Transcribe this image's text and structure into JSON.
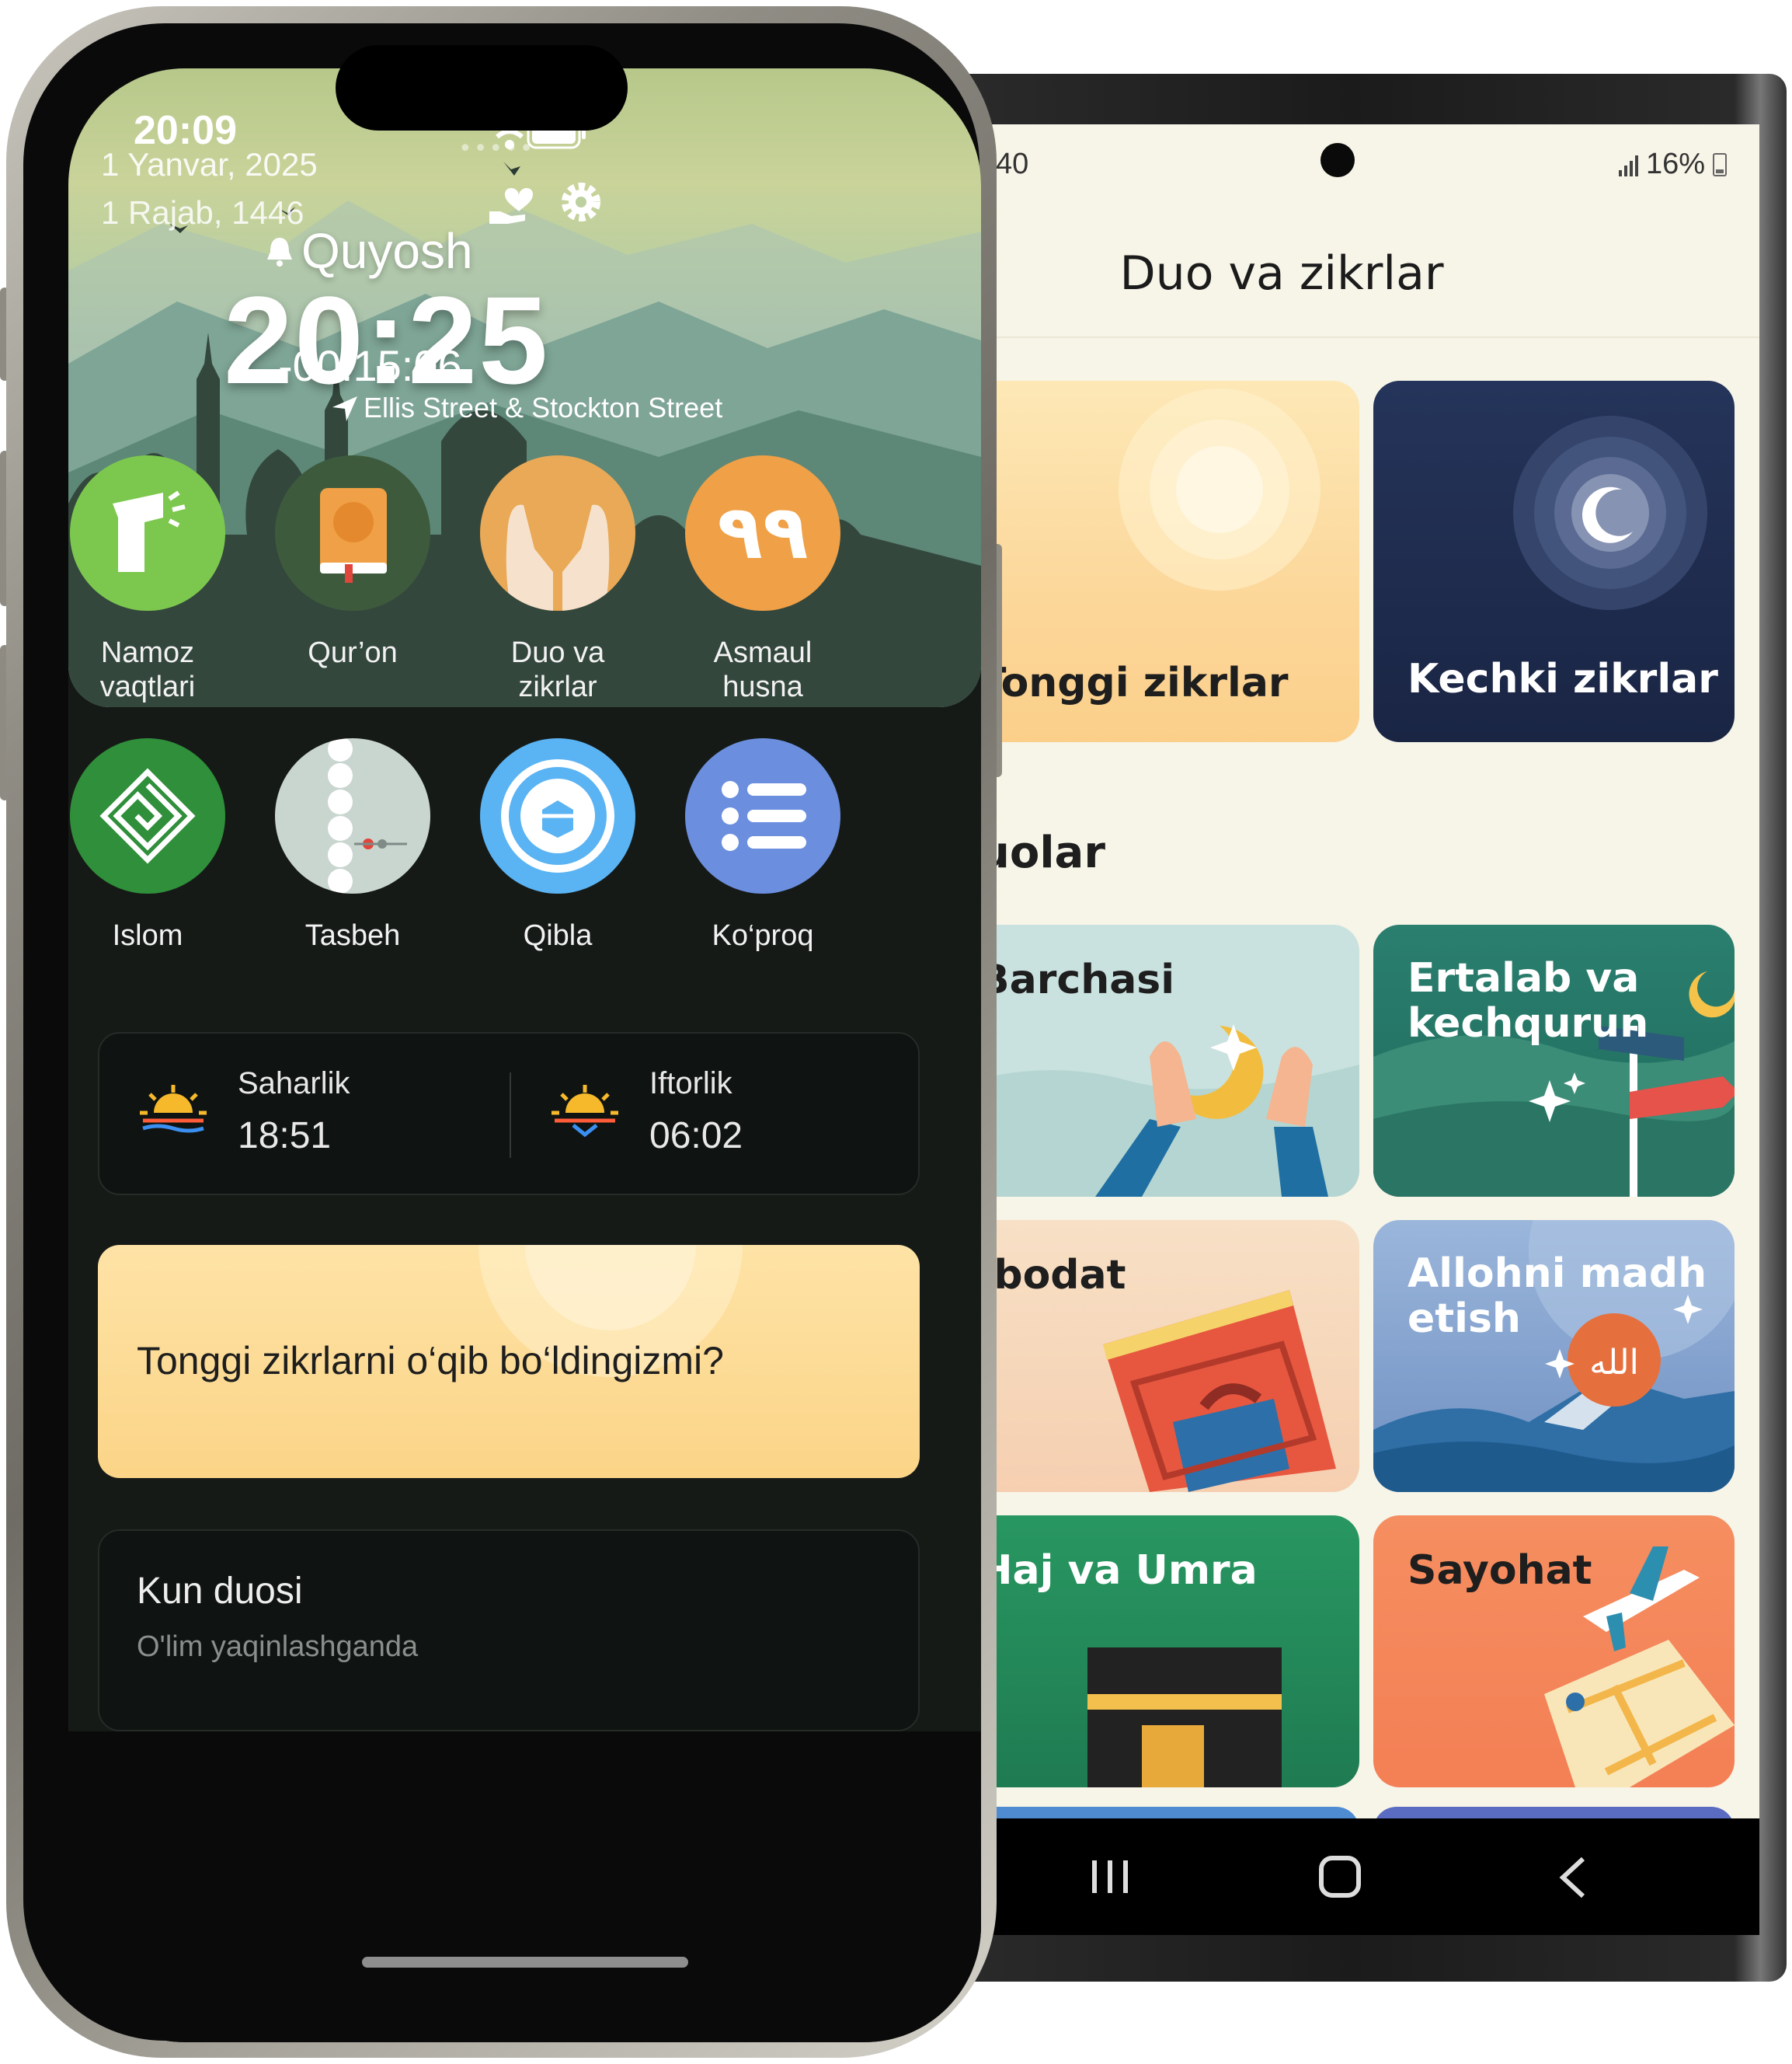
{
  "iphone": {
    "status": {
      "time": "20:09"
    },
    "hero": {
      "date_gregorian": "1 Yanvar, 2025",
      "date_hijri": "1 Rajab, 1446",
      "prayer_name": "Quyosh",
      "prayer_time": "20:25",
      "countdown": "-00:15:06",
      "location": "Ellis Street & Stockton Street"
    },
    "tiles": [
      {
        "label_l1": "Namoz",
        "label_l2": "vaqtlari",
        "color": "#7cc84e"
      },
      {
        "label_l1": "Qur’on",
        "label_l2": "",
        "color": "#3d5b3c"
      },
      {
        "label_l1": "Duo va",
        "label_l2": "zikrlar",
        "color": "#e9a956"
      },
      {
        "label_l1": "Asmaul",
        "label_l2": "husna",
        "color": "#f0a046"
      },
      {
        "label_l1": "Islom",
        "label_l2": "",
        "color": "#2f8f3a"
      },
      {
        "label_l1": "Tasbeh",
        "label_l2": "",
        "color": "#c9d6cf"
      },
      {
        "label_l1": "Qibla",
        "label_l2": "",
        "color": "#5ab3f3"
      },
      {
        "label_l1": "Ko‘proq",
        "label_l2": "",
        "color": "#6b8fde"
      }
    ],
    "fasting": {
      "saharlik_label": "Saharlik",
      "saharlik_time": "18:51",
      "iftorlik_label": "Iftorlik",
      "iftorlik_time": "06:02"
    },
    "reminder": {
      "text": "Tonggi zikrlarni o‘qib bo‘ldingizmi?"
    },
    "daily": {
      "title": "Kun duosi",
      "subtitle": "O'lim yaqinlashganda"
    }
  },
  "android": {
    "status": {
      "time": "40",
      "battery": "16%"
    },
    "title": "Duo va zikrlar",
    "section": "uolar",
    "cards": {
      "morning": "Tonggi zikrlar",
      "evening": "Kechki zikrlar",
      "all": "Barchasi",
      "ertalab_l1": "Ertalab va",
      "ertalab_l2": "kechqurun",
      "ibodat": "Ibodat",
      "allohni_l1": "Allohni madh",
      "allohni_l2": "etish",
      "haj": "Haj va Umra",
      "sayohat": "Sayohat"
    },
    "colors": {
      "background": "#f7f4e8",
      "morning": "#fde1a3",
      "evening": "#1e2b4a"
    }
  }
}
